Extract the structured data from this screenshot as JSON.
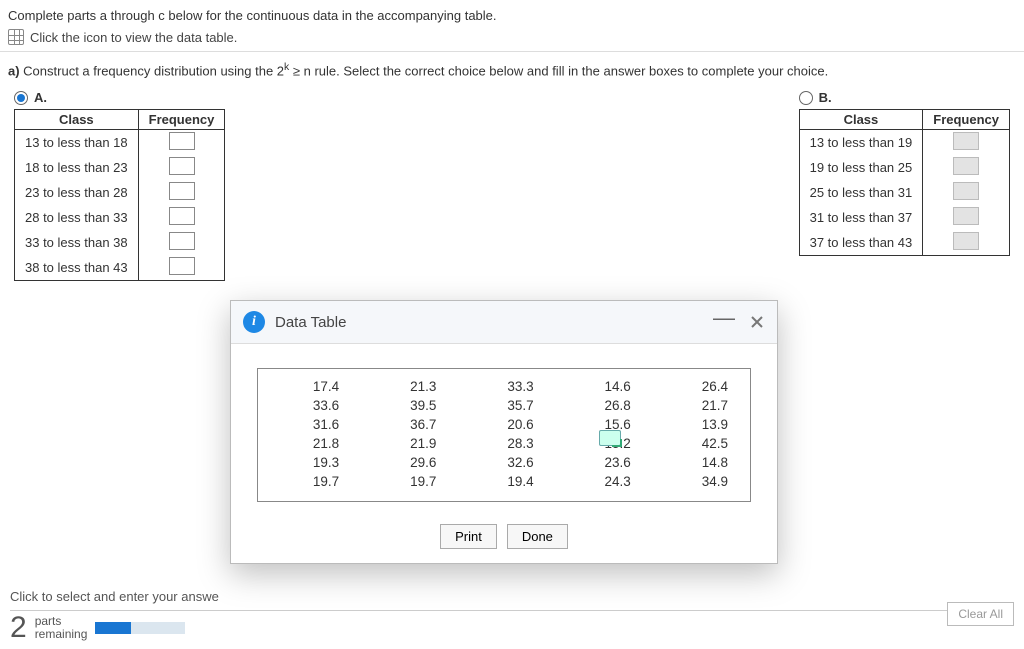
{
  "instructions": {
    "line1": "Complete parts a through c below for the continuous data in the accompanying table.",
    "line2": "Click the icon to view the data table."
  },
  "partA": {
    "prefix": "a) ",
    "text_before": "Construct a frequency distribution using the 2",
    "sup": "k",
    "text_after": " ≥ n rule. Select the correct choice below and fill in the answer boxes to complete your choice."
  },
  "choices": {
    "A": {
      "letter": "A.",
      "selected": true,
      "class_header": "Class",
      "freq_header": "Frequency",
      "rows": [
        "13 to less than 18",
        "18 to less than 23",
        "23 to less than 28",
        "28 to less than 33",
        "33 to less than 38",
        "38 to less than 43"
      ]
    },
    "B": {
      "letter": "B.",
      "selected": false,
      "class_header": "Class",
      "freq_header": "Frequency",
      "rows": [
        "13 to less than 19",
        "19 to less than 25",
        "25 to less than 31",
        "31 to less than 37",
        "37 to less than 43"
      ]
    }
  },
  "dialog": {
    "title": "Data Table",
    "data": [
      [
        "17.4",
        "21.3",
        "33.3",
        "14.6",
        "26.4"
      ],
      [
        "33.6",
        "39.5",
        "35.7",
        "26.8",
        "21.7"
      ],
      [
        "31.6",
        "36.7",
        "20.6",
        "15.6",
        "13.9"
      ],
      [
        "21.8",
        "21.9",
        "28.3",
        "15.2",
        "42.5"
      ],
      [
        "19.3",
        "29.6",
        "32.6",
        "23.6",
        "14.8"
      ],
      [
        "19.7",
        "19.7",
        "19.4",
        "24.3",
        "34.9"
      ]
    ],
    "print": "Print",
    "done": "Done"
  },
  "bottom": {
    "hint": "Click to select and enter your answe",
    "big": "2",
    "parts": "parts",
    "remaining": "remaining",
    "clear": "Clear All"
  }
}
